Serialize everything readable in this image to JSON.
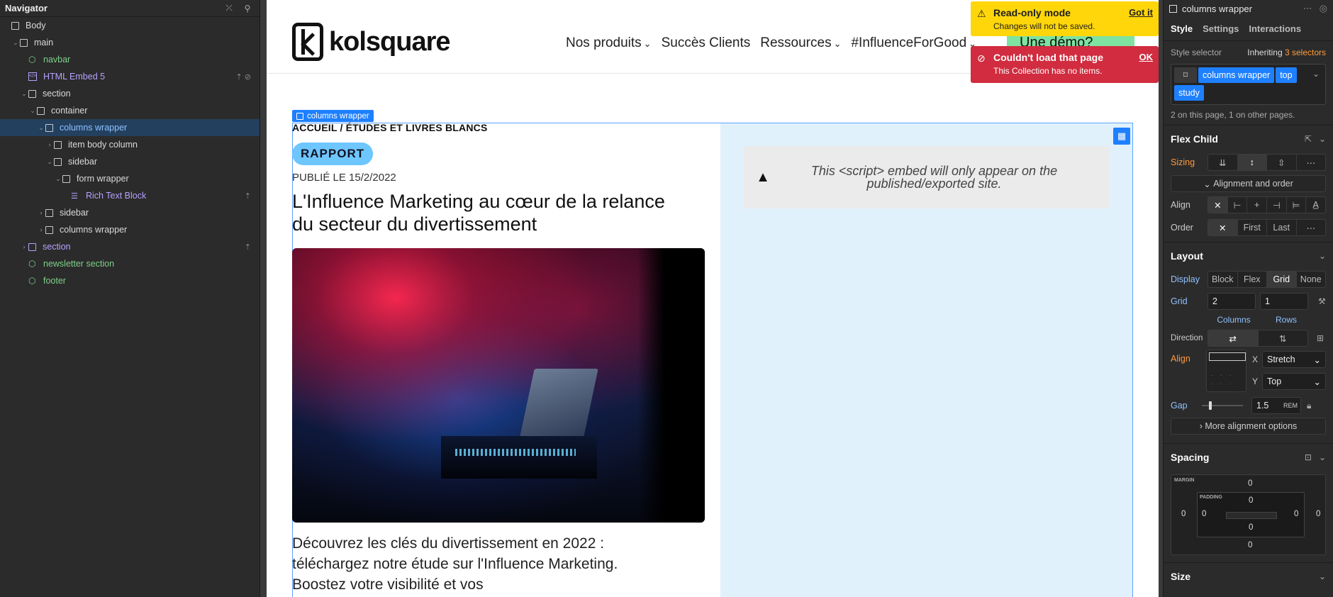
{
  "navigator": {
    "title": "Navigator",
    "items": [
      {
        "label": "Body",
        "indent": 0,
        "caret": "",
        "kind": "box"
      },
      {
        "label": "main",
        "indent": 1,
        "caret": "v",
        "kind": "box"
      },
      {
        "label": "navbar",
        "indent": 2,
        "caret": "",
        "kind": "comp"
      },
      {
        "label": "HTML Embed 5",
        "indent": 2,
        "caret": "",
        "kind": "embed"
      },
      {
        "label": "section",
        "indent": 2,
        "caret": "v",
        "kind": "box"
      },
      {
        "label": "container",
        "indent": 3,
        "caret": "v",
        "kind": "box"
      },
      {
        "label": "columns wrapper",
        "indent": 4,
        "caret": "v",
        "kind": "box",
        "selected": true
      },
      {
        "label": "item body column",
        "indent": 5,
        "caret": ">",
        "kind": "box"
      },
      {
        "label": "sidebar",
        "indent": 5,
        "caret": "v",
        "kind": "box"
      },
      {
        "label": "form wrapper",
        "indent": 6,
        "caret": "v",
        "kind": "box"
      },
      {
        "label": "Rich Text Block",
        "indent": 7,
        "caret": "",
        "kind": "rt"
      },
      {
        "label": "sidebar",
        "indent": 4,
        "caret": ">",
        "kind": "box"
      },
      {
        "label": "columns wrapper",
        "indent": 4,
        "caret": ">",
        "kind": "box"
      },
      {
        "label": "section",
        "indent": 2,
        "caret": ">",
        "kind": "purple"
      },
      {
        "label": "newsletter section",
        "indent": 2,
        "caret": "",
        "kind": "comp"
      },
      {
        "label": "footer",
        "indent": 2,
        "caret": "",
        "kind": "comp"
      }
    ]
  },
  "site": {
    "logo_text": "kolsquare",
    "nav": [
      "Nos produits",
      "Succès Clients",
      "Ressources",
      "#InfluenceForGood"
    ],
    "demo_button": "Une démo?",
    "element_label": "columns wrapper",
    "breadcrumb": "ACCUEIL / ÉTUDES ET LIVRES BLANCS",
    "badge": "RAPPORT",
    "published": "PUBLIÉ LE 15/2/2022",
    "headline": "L'Influence Marketing au cœur de la relance du secteur du divertissement",
    "intro": "Découvrez les clés du divertissement en 2022 : téléchargez notre étude sur l'Influence Marketing. Boostez votre visibilité et vos",
    "embed_placeholder": "This <script> embed will only appear on the published/exported site."
  },
  "toasts": {
    "readonly": {
      "title": "Read-only mode",
      "sub": "Changes will not be saved.",
      "action": "Got it"
    },
    "error": {
      "title": "Couldn't load that page",
      "sub": "This Collection has no items.",
      "action": "OK"
    }
  },
  "panel": {
    "element_name": "columns wrapper",
    "tabs": [
      "Style",
      "Settings",
      "Interactions"
    ],
    "style_selector_label": "Style selector",
    "inheriting": "Inheriting",
    "inheriting_count": "3 selectors",
    "chips": [
      "columns wrapper",
      "top",
      "study"
    ],
    "usage": "2 on this page, 1 on other pages.",
    "flex_child": {
      "title": "Flex Child",
      "sizing_label": "Sizing",
      "alignment_order": "Alignment and order",
      "align_label": "Align",
      "order_label": "Order",
      "order_options": [
        "First",
        "Last"
      ]
    },
    "layout": {
      "title": "Layout",
      "display_label": "Display",
      "display_options": [
        "Block",
        "Flex",
        "Grid",
        "None"
      ],
      "display_active": "Grid",
      "grid_label": "Grid",
      "columns_value": "2",
      "rows_value": "1",
      "columns_label": "Columns",
      "rows_label": "Rows",
      "direction_label": "Direction",
      "align_label": "Align",
      "x_label": "X",
      "x_value": "Stretch",
      "y_label": "Y",
      "y_value": "Top",
      "gap_label": "Gap",
      "gap_value": "1.5",
      "gap_unit": "REM",
      "more_alignment": "More alignment options"
    },
    "spacing": {
      "title": "Spacing",
      "margin_tag": "MARGIN",
      "padding_tag": "PADDING",
      "margin": {
        "top": "0",
        "right": "0",
        "bottom": "0",
        "left": "0"
      },
      "padding": {
        "top": "0",
        "right": "0",
        "bottom": "0",
        "left": "0"
      }
    },
    "size_title": "Size"
  },
  "colors": {
    "accent_blue": "#1e80ff",
    "selection_bg": "#23405f",
    "toast_yellow": "#ffd60a",
    "toast_red": "#d12c3f",
    "badge_blue": "#6ec6ff",
    "demo_green": "#7ee2a0",
    "sidebar_bg": "#e1f1fc"
  }
}
